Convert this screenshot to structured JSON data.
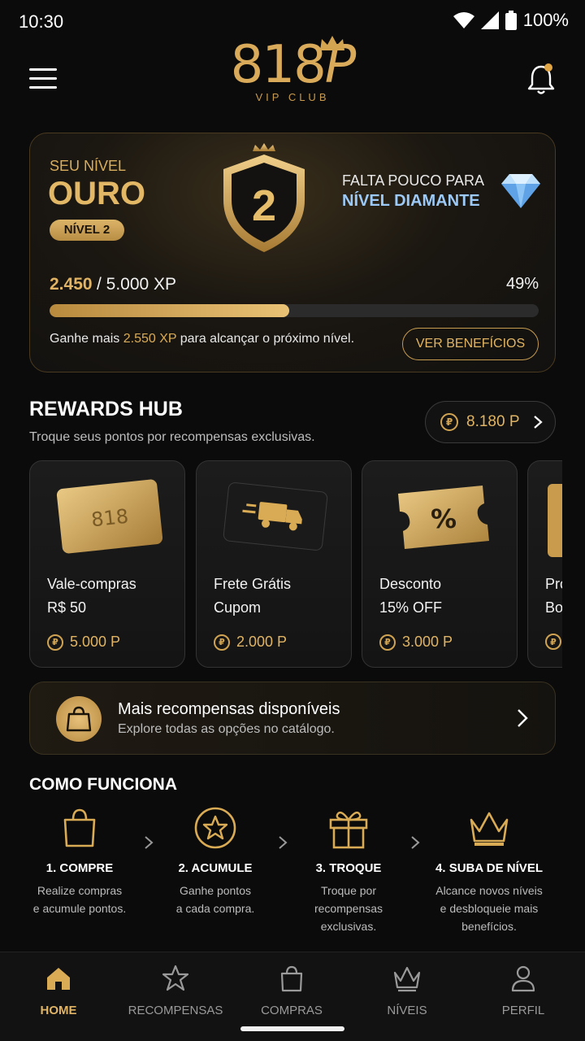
{
  "status_bar": {
    "time": "10:30",
    "battery": "100%"
  },
  "header": {
    "logo_mark": "818",
    "logo_p": "P",
    "logo_sub": "VIP CLUB"
  },
  "level": {
    "label": "SEU NÍVEL",
    "name": "OURO",
    "pill": "NÍVEL 2",
    "shield_number": "2",
    "next_label": "FALTA POUCO PARA",
    "next_name": "NÍVEL DIAMANTE",
    "xp_current": "2.450",
    "xp_rest": "/ 5.000 XP",
    "percent_text": "49%",
    "progress": 0.49,
    "hint_prefix": "Ganhe mais ",
    "hint_xp": "2.550 XP",
    "hint_suffix": " para alcançar o próximo nível.",
    "benefits_button": "VER BENEFÍCIOS"
  },
  "hub": {
    "title": "REWARDS HUB",
    "subtitle": "Troque seus pontos por recompensas exclusivas.",
    "points": "8.180 P",
    "rewards": [
      {
        "line1": "Vale-compras",
        "line2": "R$ 50",
        "cost": "5.000 P",
        "icon": "gift-card-icon"
      },
      {
        "line1": "Frete Grátis",
        "line2": "Cupom",
        "cost": "2.000 P",
        "icon": "truck-icon"
      },
      {
        "line1": "Desconto",
        "line2": "15% OFF",
        "cost": "3.000 P",
        "icon": "coupon-icon"
      },
      {
        "line1": "Pro",
        "line2": "Bo",
        "cost": "",
        "icon": "card-icon"
      }
    ]
  },
  "more": {
    "title": "Mais recompensas disponíveis",
    "subtitle": "Explore todas as opções no catálogo."
  },
  "how": {
    "title": "COMO FUNCIONA",
    "steps": [
      {
        "title": "1. COMPRE",
        "desc1": "Realize compras",
        "desc2": "e acumule pontos.",
        "desc3": "",
        "icon": "shopping-bag-icon"
      },
      {
        "title": "2. ACUMULE",
        "desc1": "Ganhe pontos",
        "desc2": "a cada compra.",
        "desc3": "",
        "icon": "star-icon"
      },
      {
        "title": "3. TROQUE",
        "desc1": "Troque por",
        "desc2": "recompensas",
        "desc3": "exclusivas.",
        "icon": "gift-icon"
      },
      {
        "title": "4. SUBA DE NÍVEL",
        "desc1": "Alcance novos níveis",
        "desc2": "e desbloqueie mais",
        "desc3": "benefícios.",
        "icon": "crown-icon"
      }
    ]
  },
  "nav": {
    "items": [
      {
        "label": "HOME",
        "icon": "home-icon"
      },
      {
        "label": "RECOMPENSAS",
        "icon": "star-icon"
      },
      {
        "label": "COMPRAS",
        "icon": "bag-icon"
      },
      {
        "label": "NÍVEIS",
        "icon": "crown-icon"
      },
      {
        "label": "PERFIL",
        "icon": "user-icon"
      }
    ]
  },
  "colors": {
    "accent": "#d9ab55",
    "background": "#0b0b0b",
    "diamond": "#9cc9f6"
  }
}
